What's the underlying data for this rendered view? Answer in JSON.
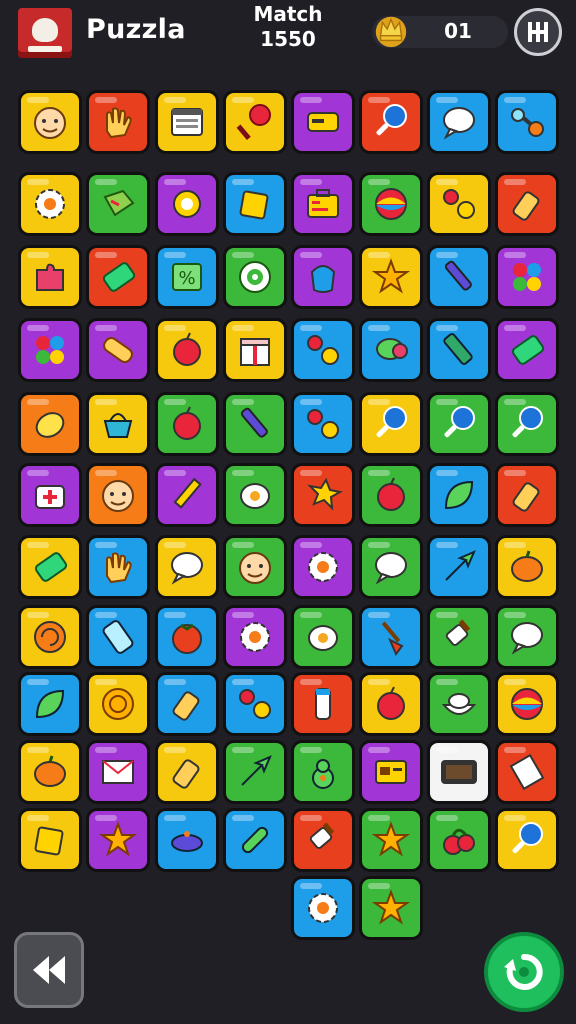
{
  "header": {
    "title": "Puzzla",
    "match_label": "Match",
    "match_score": "1550",
    "coins": "01",
    "menu_icon": "grid-menu-icon"
  },
  "colors": {
    "yellow": "#f6c90e",
    "orange": "#f57c17",
    "red": "#e8401f",
    "green": "#3cb83b",
    "blue": "#1e9de8",
    "purple": "#a235d6",
    "teal": "#19a8d6",
    "white": "#f4f4f4",
    "bg": "#1f1f25"
  },
  "board": {
    "rows": [
      [
        {
          "c": "yellow",
          "i": "face-icon"
        },
        {
          "c": "red",
          "i": "hand-icon"
        },
        {
          "c": "yellow",
          "i": "window-icon"
        },
        {
          "c": "yellow",
          "i": "racket-icon"
        },
        {
          "c": "purple",
          "i": "card-icon"
        },
        {
          "c": "red",
          "i": "paddle-icon"
        },
        {
          "c": "blue",
          "i": "speech-bubble-icon"
        },
        {
          "c": "blue",
          "i": "dumbbell-icon"
        }
      ],
      [
        {
          "c": "yellow",
          "i": "gear-icon"
        },
        {
          "c": "green",
          "i": "box-icon"
        },
        {
          "c": "purple",
          "i": "ring-icon"
        },
        {
          "c": "blue",
          "i": "cube-icon"
        },
        {
          "c": "purple",
          "i": "briefcase-icon"
        },
        {
          "c": "green",
          "i": "ball-icon"
        },
        {
          "c": "yellow",
          "i": "dots-icon"
        },
        {
          "c": "red",
          "i": "bottle-icon"
        }
      ],
      [
        {
          "c": "yellow",
          "i": "puzzle-piece-icon"
        },
        {
          "c": "red",
          "i": "battery-icon"
        },
        {
          "c": "blue",
          "i": "percent-icon"
        },
        {
          "c": "green",
          "i": "target-icon"
        },
        {
          "c": "purple",
          "i": "bag-icon"
        },
        {
          "c": "yellow",
          "i": "star-icon"
        },
        {
          "c": "blue",
          "i": "pen-icon"
        },
        {
          "c": "purple",
          "i": "flower-icon"
        }
      ],
      [
        {
          "c": "purple",
          "i": "flower-icon"
        },
        {
          "c": "purple",
          "i": "bandage-icon"
        },
        {
          "c": "yellow",
          "i": "apple-icon"
        },
        {
          "c": "yellow",
          "i": "gift-icon"
        },
        {
          "c": "blue",
          "i": "dots-icon"
        },
        {
          "c": "blue",
          "i": "candy-icon"
        },
        {
          "c": "blue",
          "i": "flashlight-icon"
        },
        {
          "c": "purple",
          "i": "battery-icon"
        }
      ],
      [
        {
          "c": "orange",
          "i": "lemon-icon"
        },
        {
          "c": "yellow",
          "i": "basket-icon"
        },
        {
          "c": "green",
          "i": "apple-icon"
        },
        {
          "c": "green",
          "i": "pen-icon"
        },
        {
          "c": "blue",
          "i": "dots-icon"
        },
        {
          "c": "yellow",
          "i": "paddle-icon"
        },
        {
          "c": "green",
          "i": "paddle-icon"
        },
        {
          "c": "green",
          "i": "paddle-icon"
        }
      ],
      [
        {
          "c": "purple",
          "i": "first-aid-icon"
        },
        {
          "c": "orange",
          "i": "face-icon"
        },
        {
          "c": "purple",
          "i": "pencil-icon"
        },
        {
          "c": "green",
          "i": "egg-icon"
        },
        {
          "c": "red",
          "i": "wand-icon"
        },
        {
          "c": "green",
          "i": "apple-icon"
        },
        {
          "c": "blue",
          "i": "leaf-icon"
        },
        {
          "c": "red",
          "i": "bottle-icon"
        }
      ],
      [
        {
          "c": "yellow",
          "i": "battery-icon"
        },
        {
          "c": "blue",
          "i": "hand-icon"
        },
        {
          "c": "yellow",
          "i": "speech-bubble-icon"
        },
        {
          "c": "green",
          "i": "face-icon"
        },
        {
          "c": "purple",
          "i": "gear-icon"
        },
        {
          "c": "green",
          "i": "speech-bubble-icon"
        },
        {
          "c": "blue",
          "i": "arrow-icon"
        },
        {
          "c": "yellow",
          "i": "pumpkin-icon"
        }
      ],
      [
        {
          "c": "yellow",
          "i": "shell-icon"
        },
        {
          "c": "blue",
          "i": "phone-icon"
        },
        {
          "c": "blue",
          "i": "tomato-icon"
        },
        {
          "c": "purple",
          "i": "gear-icon"
        },
        {
          "c": "green",
          "i": "egg-icon"
        },
        {
          "c": "blue",
          "i": "shovel-icon"
        },
        {
          "c": "green",
          "i": "brush-icon"
        },
        {
          "c": "green",
          "i": "speech-bubble-icon"
        }
      ],
      [
        {
          "c": "blue",
          "i": "leaf-icon"
        },
        {
          "c": "yellow",
          "i": "coin-icon"
        },
        {
          "c": "blue",
          "i": "bottle-icon"
        },
        {
          "c": "blue",
          "i": "dots-icon"
        },
        {
          "c": "red",
          "i": "tube-icon"
        },
        {
          "c": "yellow",
          "i": "apple-icon"
        },
        {
          "c": "green",
          "i": "bowl-icon"
        },
        {
          "c": "yellow",
          "i": "ball-icon"
        }
      ],
      [
        {
          "c": "yellow",
          "i": "pumpkin-icon"
        },
        {
          "c": "purple",
          "i": "envelope-icon"
        },
        {
          "c": "yellow",
          "i": "bottle-icon"
        },
        {
          "c": "green",
          "i": "arrow-icon"
        },
        {
          "c": "green",
          "i": "pear-icon"
        },
        {
          "c": "purple",
          "i": "id-card-icon"
        },
        {
          "c": "white",
          "i": "tablet-icon"
        },
        {
          "c": "red",
          "i": "paper-icon"
        }
      ],
      [
        {
          "c": "yellow",
          "i": "cube-icon"
        },
        {
          "c": "purple",
          "i": "star-icon"
        },
        {
          "c": "blue",
          "i": "pot-icon"
        },
        {
          "c": "blue",
          "i": "pill-icon"
        },
        {
          "c": "red",
          "i": "brush-icon"
        },
        {
          "c": "green",
          "i": "star-icon"
        },
        {
          "c": "green",
          "i": "cherry-icon"
        },
        {
          "c": "yellow",
          "i": "paddle-icon"
        }
      ],
      [
        {
          "c": "blue",
          "i": "gear-icon"
        },
        {
          "c": "green",
          "i": "star-icon"
        }
      ]
    ]
  },
  "controls": {
    "back_icon": "rewind-icon",
    "refresh_icon": "refresh-icon"
  }
}
